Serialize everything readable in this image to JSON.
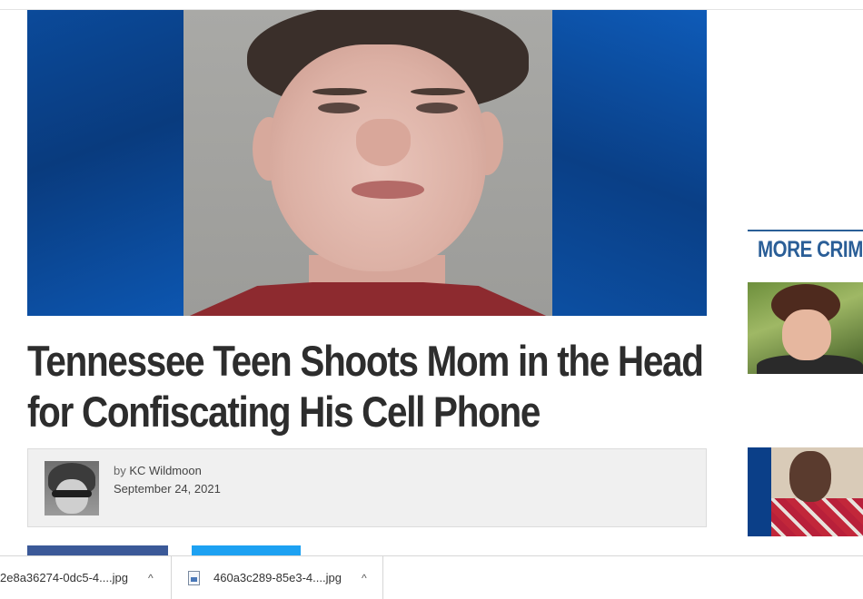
{
  "article": {
    "headline": "Tennessee Teen Shoots Mom in the Head for Confiscating His Cell Phone",
    "byline_prefix": "by",
    "author": "KC Wildmoon",
    "date": "September 24, 2021"
  },
  "sidebar": {
    "section_title": "MORE CRIM"
  },
  "downloads": {
    "items": [
      {
        "filename": "2e8a36274-0dc5-4....jpg"
      },
      {
        "filename": "460a3c289-85e3-4....jpg"
      }
    ],
    "chevron_glyph": "^"
  },
  "colors": {
    "headline": "#2d2d2d",
    "sidebar_accent": "#2a5e97",
    "facebook": "#3b5998",
    "twitter": "#1da1f2"
  }
}
